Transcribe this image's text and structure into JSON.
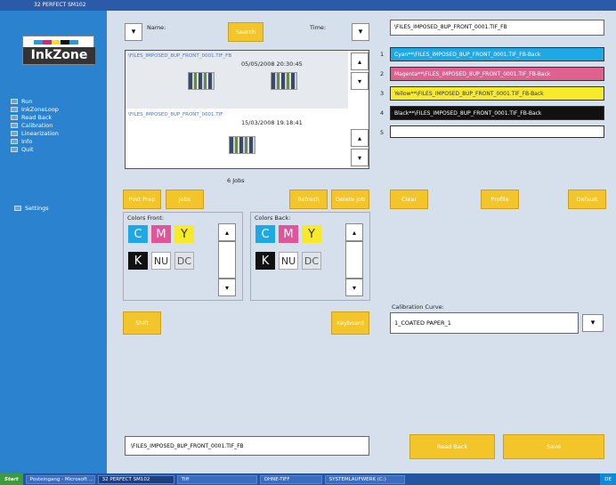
{
  "window": {
    "title": "32 PERFECT SM102"
  },
  "sidebar": {
    "logo_text": "InkZone",
    "logo_colors": [
      "#1a9fe0",
      "#e0207a",
      "#f4e020",
      "#111111"
    ],
    "items": [
      {
        "label": "Run"
      },
      {
        "label": "InkZoneLoop"
      },
      {
        "label": "Read Back"
      },
      {
        "label": "Calibration"
      },
      {
        "label": "Linearization"
      },
      {
        "label": "Info"
      },
      {
        "label": "Quit"
      }
    ],
    "settings_label": "Settings"
  },
  "filters": {
    "name_label": "Name:",
    "time_label": "Time:",
    "search_label": "Search",
    "dropdown_glyph": "▾"
  },
  "jobs": {
    "count_text": "6 Jobs",
    "list": [
      {
        "name": "\\FILES_IMPOSED_8UP_FRONT_0001.TIF_FB",
        "date": "05/05/2008 20:30:45"
      },
      {
        "name": "\\FILES_IMPOSED_8UP_FRONT_0001.TIF",
        "date": "15/03/2008 19:18:41"
      }
    ],
    "scroll_up": "▴",
    "scroll_down": "▾"
  },
  "separations": {
    "title_value": "\\FILES_IMPOSED_8UP_FRONT_0001.TIF_FB",
    "rows": [
      {
        "num": "1",
        "text": "Cyan**\\FILES_IMPOSED_8UP_FRONT_0001.TIF_FB-Back",
        "color": "#1ea9e6"
      },
      {
        "num": "2",
        "text": "Magenta**\\FILES_IMPOSED_8UP_FRONT_0001.TIF_FB-Back",
        "color": "#e0608f"
      },
      {
        "num": "3",
        "text": "Yellow**\\FILES_IMPOSED_8UP_FRONT_0001.TIF_FB-Back",
        "color": "#f6ea2a"
      },
      {
        "num": "4",
        "text": "Black**\\FILES_IMPOSED_8UP_FRONT_0001.TIF_FB-Back",
        "color": "#111111"
      },
      {
        "num": "5",
        "text": "",
        "color": "#ffffff"
      }
    ]
  },
  "buttons": {
    "post_prep": "Post Prep",
    "jobs": "Jobs",
    "refresh": "Refresh",
    "delete_job": "Delete job",
    "clear": "Clear",
    "profile": "Profile",
    "default": "Default",
    "shift": "Shift",
    "keyboard": "Keyboard",
    "read_back": "Read Back",
    "save": "Save"
  },
  "colors_front": {
    "label": "Colors Front:",
    "inks": [
      {
        "text": "C",
        "color": "#1ea9e6",
        "fg": "#ffffff"
      },
      {
        "text": "M",
        "color": "#e0559a",
        "fg": "#ffffff"
      },
      {
        "text": "Y",
        "color": "#f6ea2a",
        "fg": "#333333"
      },
      {
        "text": "K",
        "color": "#111111",
        "fg": "#ffffff"
      },
      {
        "text": "NU",
        "color": "#ffffff",
        "fg": "#333333"
      },
      {
        "text": "DC",
        "color": "#dfe3ea",
        "fg": "#555555"
      }
    ]
  },
  "colors_back": {
    "label": "Colors Back:",
    "inks": [
      {
        "text": "C",
        "color": "#1ea9e6",
        "fg": "#ffffff"
      },
      {
        "text": "M",
        "color": "#e0559a",
        "fg": "#ffffff"
      },
      {
        "text": "Y",
        "color": "#f6ea2a",
        "fg": "#333333"
      },
      {
        "text": "K",
        "color": "#111111",
        "fg": "#ffffff"
      },
      {
        "text": "NU",
        "color": "#ffffff",
        "fg": "#333333"
      },
      {
        "text": "DC",
        "color": "#dfe3ea",
        "fg": "#555555"
      }
    ]
  },
  "calibration": {
    "label": "Calibration Curve:",
    "value": "1_COATED PAPER_1"
  },
  "footer": {
    "file_value": "\\FILES_IMPOSED_8UP_FRONT_0001.TIF_FB"
  },
  "taskbar": {
    "start": "Start",
    "items": [
      "Posteingang - Microsoft ...",
      "32 PERFECT SM102",
      "Tiff",
      "OHNE-TIFF",
      "SYSTEMLAUFWERK (C:)"
    ],
    "tray": "DE"
  },
  "accent": "#f3c52a"
}
